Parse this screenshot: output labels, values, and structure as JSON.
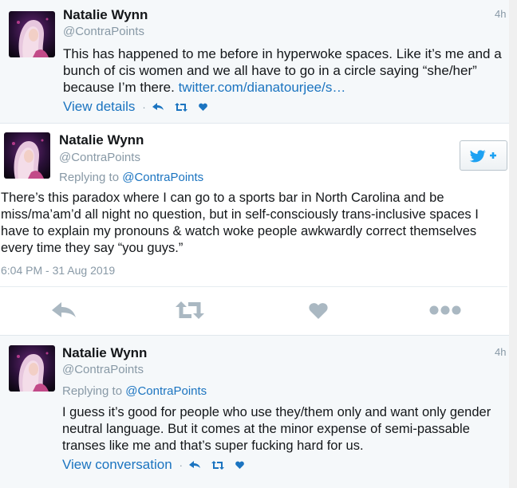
{
  "colors": {
    "link": "#1b74c0",
    "muted": "#8899a6",
    "twitter_blue": "#1da1f2"
  },
  "tweets": [
    {
      "name": "Natalie Wynn",
      "handle": "@ContraPoints",
      "time": "4h",
      "text": "This has happened to me before in hyperwoke spaces. Like it’s me and a bunch of cis women and we all have to go in a circle saying “she/her” because I’m there. ",
      "link": "twitter.com/dianatourjee/s…",
      "action_link": "View details",
      "icons": [
        "reply-icon",
        "retweet-icon",
        "like-icon"
      ]
    },
    {
      "name": "Natalie Wynn",
      "handle": "@ContraPoints",
      "replying_prefix": "Replying to ",
      "replying_to": "@ContraPoints",
      "text": "There’s this paradox where I can go to a sports bar in North Carolina and be miss/ma’am’d all night no question, but in self-consciously trans-inclusive spaces I have to explain my pronouns & watch woke people awkwardly correct themselves every time they say “you guys.”",
      "timestamp": "6:04 PM - 31 Aug 2019",
      "follow_icon": "twitter-bird-follow-icon",
      "icons": [
        "reply-icon",
        "retweet-icon",
        "like-icon",
        "more-icon"
      ]
    },
    {
      "name": "Natalie Wynn",
      "handle": "@ContraPoints",
      "time": "4h",
      "replying_prefix": "Replying to ",
      "replying_to": "@ContraPoints",
      "text": "I guess it’s good for people who use they/them only and want only gender neutral language. But it comes at the minor expense of semi-passable transes like me and that’s super fucking hard for us.",
      "action_link": "View conversation",
      "icons": [
        "reply-icon",
        "retweet-icon",
        "like-icon"
      ]
    }
  ]
}
